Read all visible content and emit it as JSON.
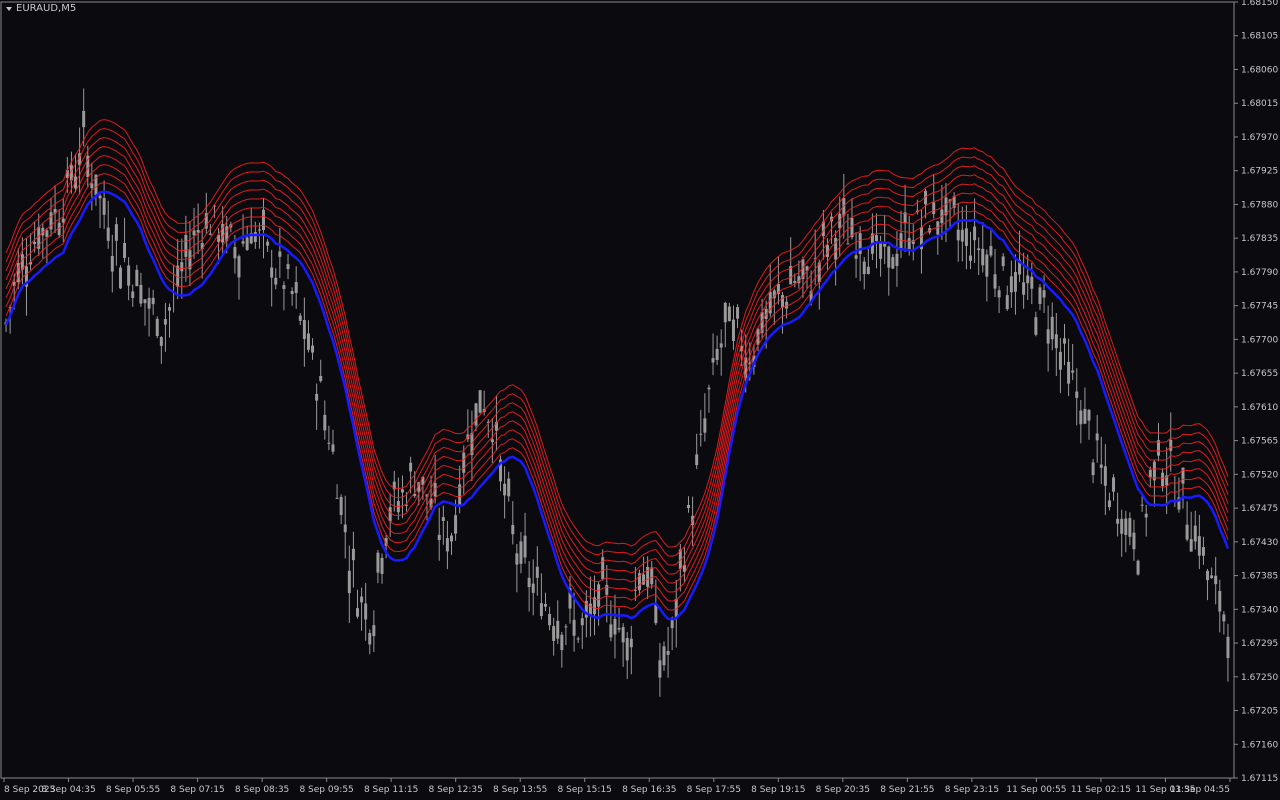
{
  "window": {
    "symbol": "EURAUD,M5"
  },
  "colors": {
    "background": "#0b0b0f",
    "axis": "#8a8a8a",
    "text": "#c8c8c8",
    "candle": "#9a9a9a",
    "band": "#ff2020",
    "baseline": "#1a1aff"
  },
  "chart_data": {
    "type": "candlestick",
    "price_axis": {
      "ticks": [
        "1.68150",
        "1.68105",
        "1.68060",
        "1.68015",
        "1.67970",
        "1.67925",
        "1.67880",
        "1.67835",
        "1.67790",
        "1.67745",
        "1.67700",
        "1.67655",
        "1.67610",
        "1.67565",
        "1.67520",
        "1.67475",
        "1.67430",
        "1.67385",
        "1.67340",
        "1.67295",
        "1.67250",
        "1.67205",
        "1.67160",
        "1.67115"
      ],
      "range": [
        1.67115,
        1.6815
      ]
    },
    "time_axis": {
      "ticks": [
        "8 Sep 2023",
        "8 Sep 04:35",
        "8 Sep 05:55",
        "8 Sep 07:15",
        "8 Sep 08:35",
        "8 Sep 09:55",
        "8 Sep 11:15",
        "8 Sep 12:35",
        "8 Sep 13:55",
        "8 Sep 15:15",
        "8 Sep 16:35",
        "8 Sep 17:55",
        "8 Sep 19:15",
        "8 Sep 20:35",
        "8 Sep 21:55",
        "8 Sep 23:15",
        "11 Sep 00:55",
        "11 Sep 02:15",
        "11 Sep 03:35",
        "11 Sep 04:55"
      ]
    },
    "series": [
      {
        "name": "price",
        "values": [
          1.6772,
          1.6779,
          1.6782,
          1.6784,
          1.6786,
          1.6788,
          1.6792,
          1.6796,
          1.6791,
          1.6786,
          1.6782,
          1.678,
          1.6777,
          1.6774,
          1.6772,
          1.6775,
          1.678,
          1.6784,
          1.6786,
          1.6785,
          1.6783,
          1.6782,
          1.6785,
          1.6783,
          1.678,
          1.6778,
          1.6775,
          1.677,
          1.6765,
          1.6758,
          1.675,
          1.674,
          1.6735,
          1.6733,
          1.6745,
          1.6748,
          1.675,
          1.6752,
          1.6749,
          1.6745,
          1.6743,
          1.6752,
          1.676,
          1.6762,
          1.6758,
          1.6748,
          1.6742,
          1.6738,
          1.6736,
          1.6734,
          1.6733,
          1.6732,
          1.6731,
          1.6734,
          1.6736,
          1.6732,
          1.6729,
          1.674,
          1.6738,
          1.6726,
          1.673,
          1.6742,
          1.675,
          1.676,
          1.6768,
          1.6772,
          1.677,
          1.6768,
          1.6772,
          1.6774,
          1.6776,
          1.6778,
          1.6777,
          1.678,
          1.6783,
          1.6785,
          1.6784,
          1.6783,
          1.6782,
          1.678,
          1.6781,
          1.6784,
          1.6785,
          1.6786,
          1.6787,
          1.6786,
          1.6784,
          1.6783,
          1.6782,
          1.678,
          1.6778,
          1.6778,
          1.6776,
          1.6775,
          1.6773,
          1.6768,
          1.6764,
          1.676,
          1.6755,
          1.675,
          1.6748,
          1.6745,
          1.6743,
          1.6751,
          1.6755,
          1.6752,
          1.6748,
          1.6745,
          1.674,
          1.6735,
          1.6733
        ]
      }
    ]
  }
}
